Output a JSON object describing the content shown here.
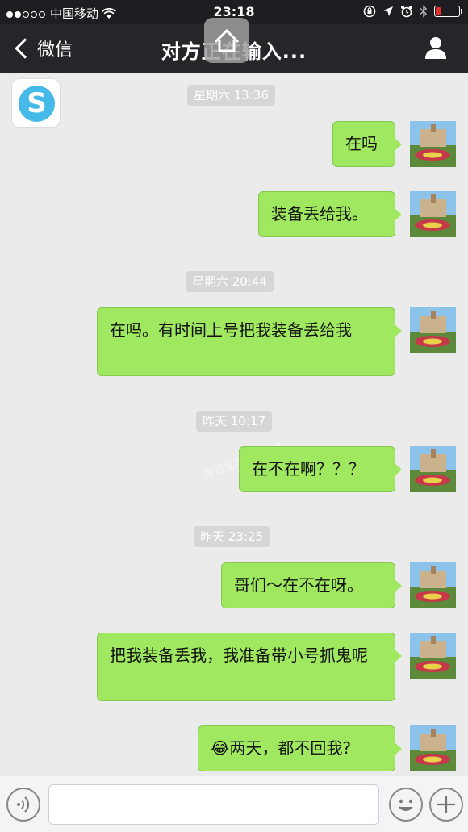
{
  "status_bar": {
    "carrier": "中国移动",
    "time": "23:18"
  },
  "nav": {
    "back_label": "微信",
    "title": "对方正在输入..."
  },
  "watermark": "每日发布游戏动态",
  "messages": [
    {
      "timestamp": "星期六 13:36",
      "text": "在吗"
    },
    {
      "text": "装备丢给我。"
    },
    {
      "timestamp": "星期六 20:44",
      "text": "在吗。有时间上号把我装备丢给我"
    },
    {
      "timestamp": "昨天 10:17",
      "text": "在不在啊？？？"
    },
    {
      "timestamp": "昨天 23:25",
      "text": "哥们～在不在呀。"
    },
    {
      "text": "把我装备丢我，我准备带小号抓鬼呢"
    },
    {
      "emoji": "😂",
      "text": "两天，都不回我?"
    }
  ],
  "input": {
    "placeholder": ""
  },
  "colors": {
    "bubble_green": "#9fe85f",
    "nav_bg": "#26262a",
    "chat_bg": "#ebebeb"
  },
  "icons": {
    "app_logo": "s-circle-logo",
    "profile": "person-icon",
    "voice": "voice-icon",
    "emoji": "smiley-icon",
    "plus": "plus-icon"
  }
}
